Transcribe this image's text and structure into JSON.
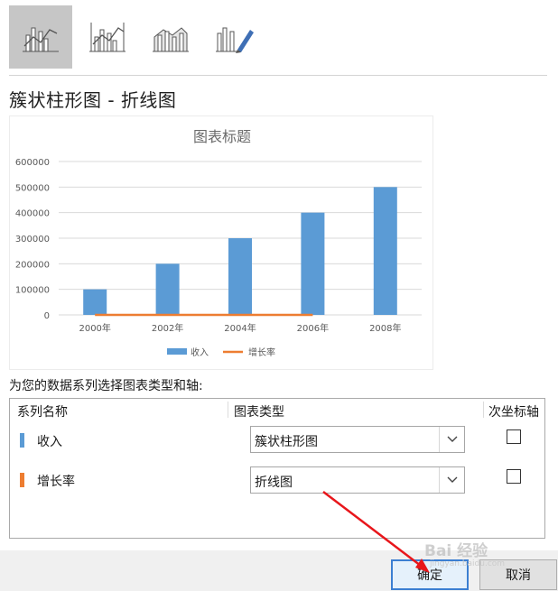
{
  "chart_types": [
    {
      "name": "clustered-column-line-icon",
      "selected": true
    },
    {
      "name": "clustered-column-line-secondary-axis-icon",
      "selected": false
    },
    {
      "name": "stacked-area-column-icon",
      "selected": false
    },
    {
      "name": "custom-combination-icon",
      "selected": false
    }
  ],
  "combo_title": "簇状柱形图 - 折线图",
  "preview": {
    "chart_data": {
      "type": "bar",
      "title": "图表标题",
      "categories": [
        "2000年",
        "2002年",
        "2004年",
        "2006年",
        "2008年"
      ],
      "ylim": [
        0,
        600000
      ],
      "yticks": [
        "0",
        "100000",
        "200000",
        "300000",
        "400000",
        "500000",
        "600000"
      ],
      "series": [
        {
          "name": "收入",
          "type": "bar",
          "color": "#5b9bd5",
          "values": [
            100000,
            200000,
            300000,
            400000,
            500000
          ]
        },
        {
          "name": "增长率",
          "type": "line",
          "color": "#ed7d31",
          "values": [
            0,
            0,
            0,
            0
          ]
        }
      ],
      "legend_position": "bottom",
      "grid": true
    }
  },
  "series_prompt": "为您的数据系列选择图表类型和轴:",
  "table": {
    "headers": {
      "name": "系列名称",
      "type": "图表类型",
      "secondary": "次坐标轴"
    },
    "rows": [
      {
        "name": "收入",
        "color": "#5b9bd5",
        "chart_type": "簇状柱形图",
        "secondary": false
      },
      {
        "name": "增长率",
        "color": "#ed7d31",
        "chart_type": "折线图",
        "secondary": false
      }
    ]
  },
  "buttons": {
    "ok": "确定",
    "cancel": "取消"
  },
  "watermark": {
    "main": "Bai 经验",
    "sub": "jingyan.baidu.com"
  },
  "colors": {
    "bar": "#5b9bd5",
    "line": "#ed7d31",
    "selected_bg": "#c6c6c6",
    "primary_border": "#3b7fd2",
    "annotation": "#e8161b"
  }
}
